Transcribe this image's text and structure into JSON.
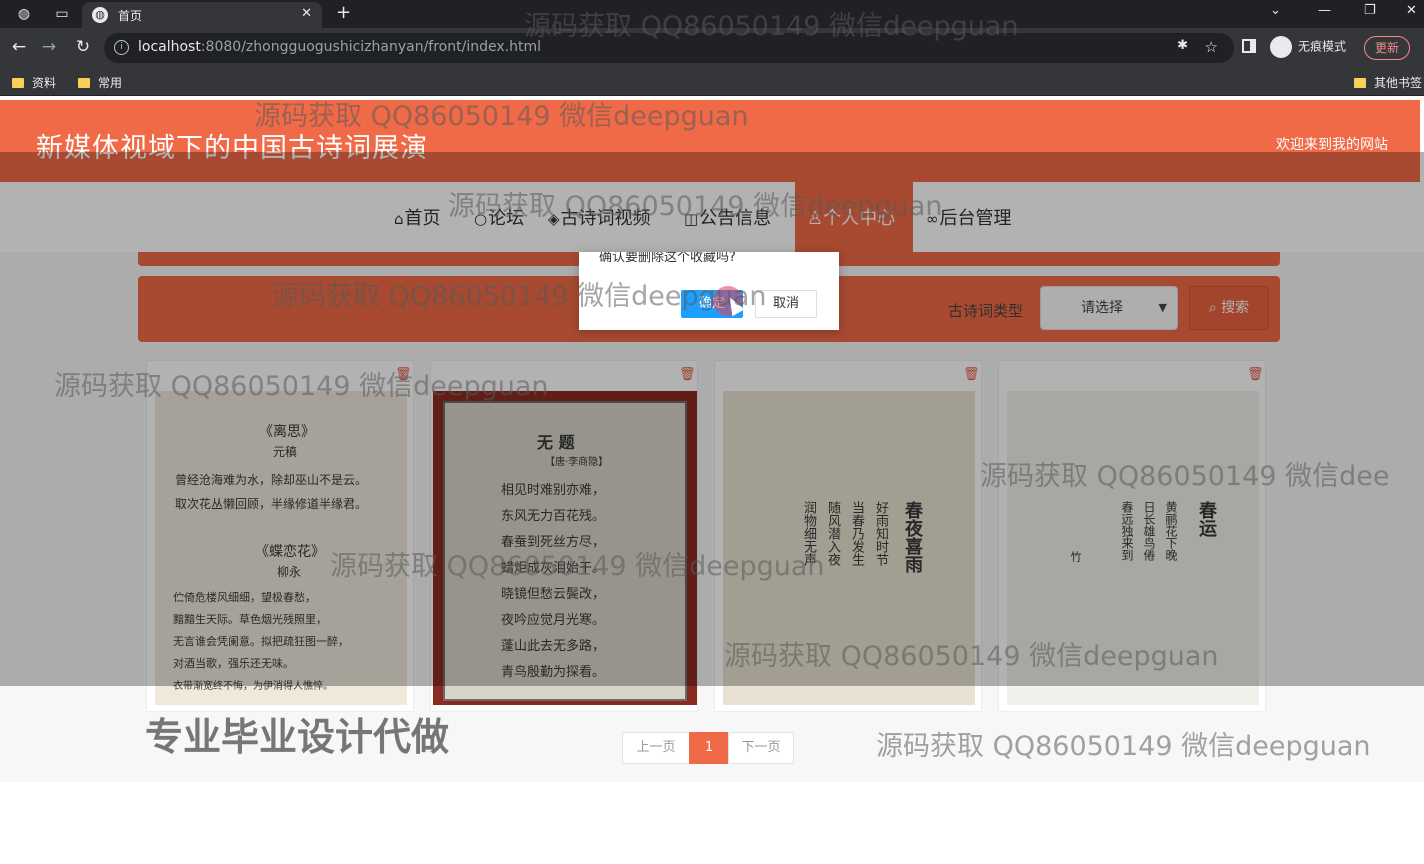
{
  "browser": {
    "tab_title": "首页",
    "url_host": "localhost",
    "url_rest": ":8080/zhongguogushicizhanyan/front/index.html",
    "incognito_label": "无痕模式",
    "update_label": "更新",
    "bookmarks": [
      "资料",
      "常用",
      "其他书签"
    ]
  },
  "site": {
    "title": "新媒体视域下的中国古诗词展演",
    "welcome": "欢迎来到我的网站"
  },
  "nav": {
    "items": [
      {
        "icon": "⌂",
        "label": "首页"
      },
      {
        "icon": "○",
        "label": "论坛"
      },
      {
        "icon": "◈",
        "label": "古诗词视频"
      },
      {
        "icon": "◫",
        "label": "公告信息"
      },
      {
        "icon": "♙",
        "label": "个人中心"
      },
      {
        "icon": "∞",
        "label": "后台管理"
      }
    ],
    "active": "个人中心"
  },
  "search": {
    "label": "古诗词类型",
    "select_value": "请选择",
    "button_label": "搜索"
  },
  "cards": [
    {
      "title": "《离思》",
      "author": "元稹",
      "lines": [
        "曾经沧海难为水，除却巫山不是云。",
        "取次花丛懒回顾，半缘修道半缘君。"
      ],
      "title2": "《蝶恋花》",
      "author2": "柳永",
      "lines2": [
        "伫倚危楼风细细，望极春愁，",
        "黯黯生天际。草色烟光残照里，",
        "无言谁会凭阑意。拟把疏狂图一醉，",
        "对酒当歌，强乐还无味。",
        "衣带渐宽终不悔，为伊消得人憔悴。"
      ]
    },
    {
      "title": "无 题",
      "author": "【唐·李商隐】",
      "lines": [
        "相见时难别亦难，",
        "东风无力百花残。",
        "春蚕到死丝方尽，",
        "蜡炬成灰泪始干。",
        "晓镜但愁云鬓改，",
        "夜吟应觉月光寒。",
        "蓬山此去无多路，",
        "青鸟殷勤为探看。"
      ]
    },
    {
      "title": "春夜喜雨",
      "lines": [
        "好雨知时节",
        "当春乃发生",
        "随风潜入夜",
        "润物细无声"
      ]
    },
    {
      "title": "春运",
      "lines": [
        "黄鹂花下晚",
        "日长雄鸟倦",
        "春远独来到",
        "竹"
      ]
    }
  ],
  "pager": {
    "prev": "上一页",
    "current": "1",
    "next": "下一页"
  },
  "dialog": {
    "message": "确认要删除这个收藏吗?",
    "ok": "确定",
    "cancel": "取消"
  },
  "watermarks": {
    "main": "源码获取 QQ86050149 微信deepguan",
    "clipped": "源码获取 QQ86050149 微信dee",
    "service": "专业毕业设计代做"
  }
}
